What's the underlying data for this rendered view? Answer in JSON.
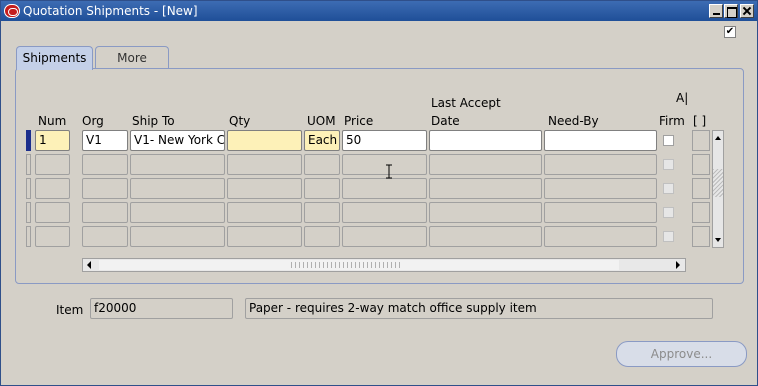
{
  "window": {
    "title": "Quotation Shipments - [New]",
    "header_checkbox": "✔"
  },
  "tabs": [
    {
      "label": "Shipments"
    },
    {
      "label": "More"
    }
  ],
  "columns": {
    "num": "Num",
    "org": "Org",
    "ship_to": "Ship To",
    "qty": "Qty",
    "uom": "UOM",
    "price": "Price",
    "last_accept_line1": "Last Accept",
    "last_accept_line2": "Date",
    "need_by": "Need-By",
    "firm": "Firm",
    "ap_top": "A|",
    "ext": "[ ]"
  },
  "rows": [
    {
      "num": "1",
      "org": "V1",
      "ship_to": "V1- New York C",
      "qty": "",
      "uom": "Each",
      "price": "50",
      "last_accept_date": "",
      "need_by": ""
    }
  ],
  "item": {
    "label": "Item",
    "code": "f20000",
    "description": "Paper - requires 2-way match office supply item"
  },
  "buttons": {
    "approve": "Approve..."
  }
}
